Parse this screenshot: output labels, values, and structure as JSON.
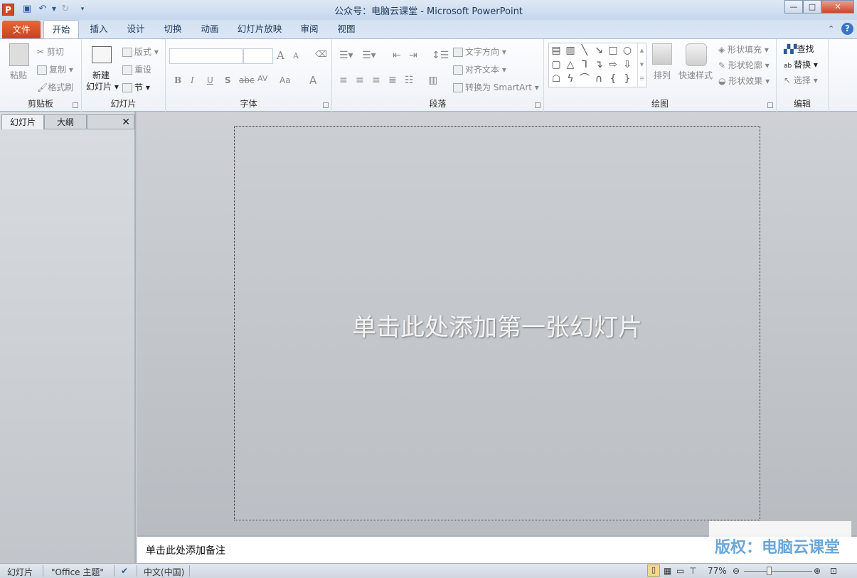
{
  "window": {
    "title": "公众号：电脑云课堂 - Microsoft PowerPoint",
    "app_icon": "P",
    "minimize": "—",
    "maximize": "□",
    "close": "✕"
  },
  "quick_access": {
    "save": "save-icon",
    "undo": "undo-icon",
    "redo": "redo-icon",
    "customize": "customize-icon"
  },
  "tabs": [
    {
      "label": "文件"
    },
    {
      "label": "开始"
    },
    {
      "label": "插入"
    },
    {
      "label": "设计"
    },
    {
      "label": "切换"
    },
    {
      "label": "动画"
    },
    {
      "label": "幻灯片放映"
    },
    {
      "label": "审阅"
    },
    {
      "label": "视图"
    }
  ],
  "ribbon": {
    "clipboard": {
      "label": "剪贴板",
      "paste": "粘贴",
      "cut": "剪切",
      "copy": "复制",
      "format_painter": "格式刷"
    },
    "slides": {
      "label": "幻灯片",
      "new_slide_1": "新建",
      "new_slide_2": "幻灯片",
      "layout": "版式",
      "reset": "重设",
      "section": "节"
    },
    "font": {
      "label": "字体",
      "font_name": "",
      "font_size": "",
      "bold": "B",
      "italic": "I",
      "underline": "U",
      "shadow": "S",
      "strike": "abc",
      "spacing": "AV",
      "case": "Aa",
      "color": "A",
      "grow": "A",
      "shrink": "A"
    },
    "paragraph": {
      "label": "段落",
      "text_direction": "文字方向",
      "align_text": "对齐文本",
      "smartart": "转换为 SmartArt"
    },
    "drawing": {
      "label": "绘图",
      "arrange": "排列",
      "quick_styles": "快速样式",
      "fill": "形状填充",
      "outline": "形状轮廓",
      "effects": "形状效果"
    },
    "editing": {
      "label": "编辑",
      "find": "查找",
      "replace": "替换",
      "select": "选择"
    }
  },
  "left_panel": {
    "tabs": [
      "幻灯片",
      "大纲"
    ],
    "close": "✕"
  },
  "slide": {
    "title_placeholder": "单击此处添加第一张幻灯片"
  },
  "notes": {
    "placeholder": "单击此处添加备注"
  },
  "watermark": "版权：电脑云课堂",
  "status": {
    "view": "幻灯片",
    "theme": "\"Office 主题\"",
    "language": "中文(中国)",
    "zoom": "77%",
    "zoom_percent": 77
  },
  "colors": {
    "file_tab": "#d24726",
    "accent": "#2b5797"
  }
}
